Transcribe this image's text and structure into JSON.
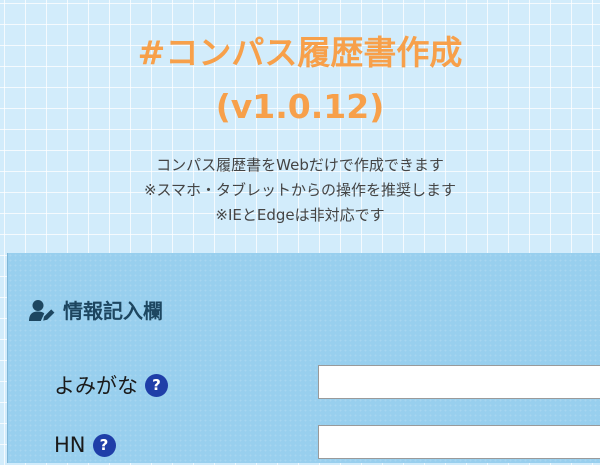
{
  "header": {
    "title_line1": "#コンパス履歴書作成",
    "title_line2": "(v1.0.12)",
    "descriptions": [
      "コンパス履歴書をWebだけで作成できます",
      "※スマホ・タブレットからの操作を推奨します",
      "※IEとEdgeは非対応です"
    ]
  },
  "section": {
    "title": "情報記入欄",
    "icon": "user-edit-icon"
  },
  "fields": [
    {
      "label": "よみがな",
      "value": "",
      "help_icon": "question-circle-icon"
    },
    {
      "label": "HN",
      "value": "",
      "help_icon": "question-circle-icon"
    }
  ],
  "colors": {
    "title": "#f7a04a",
    "background": "#d2ecfb",
    "panel": "#98cfee",
    "section_title": "#1d4660",
    "help_icon": "#1f3ea8"
  }
}
